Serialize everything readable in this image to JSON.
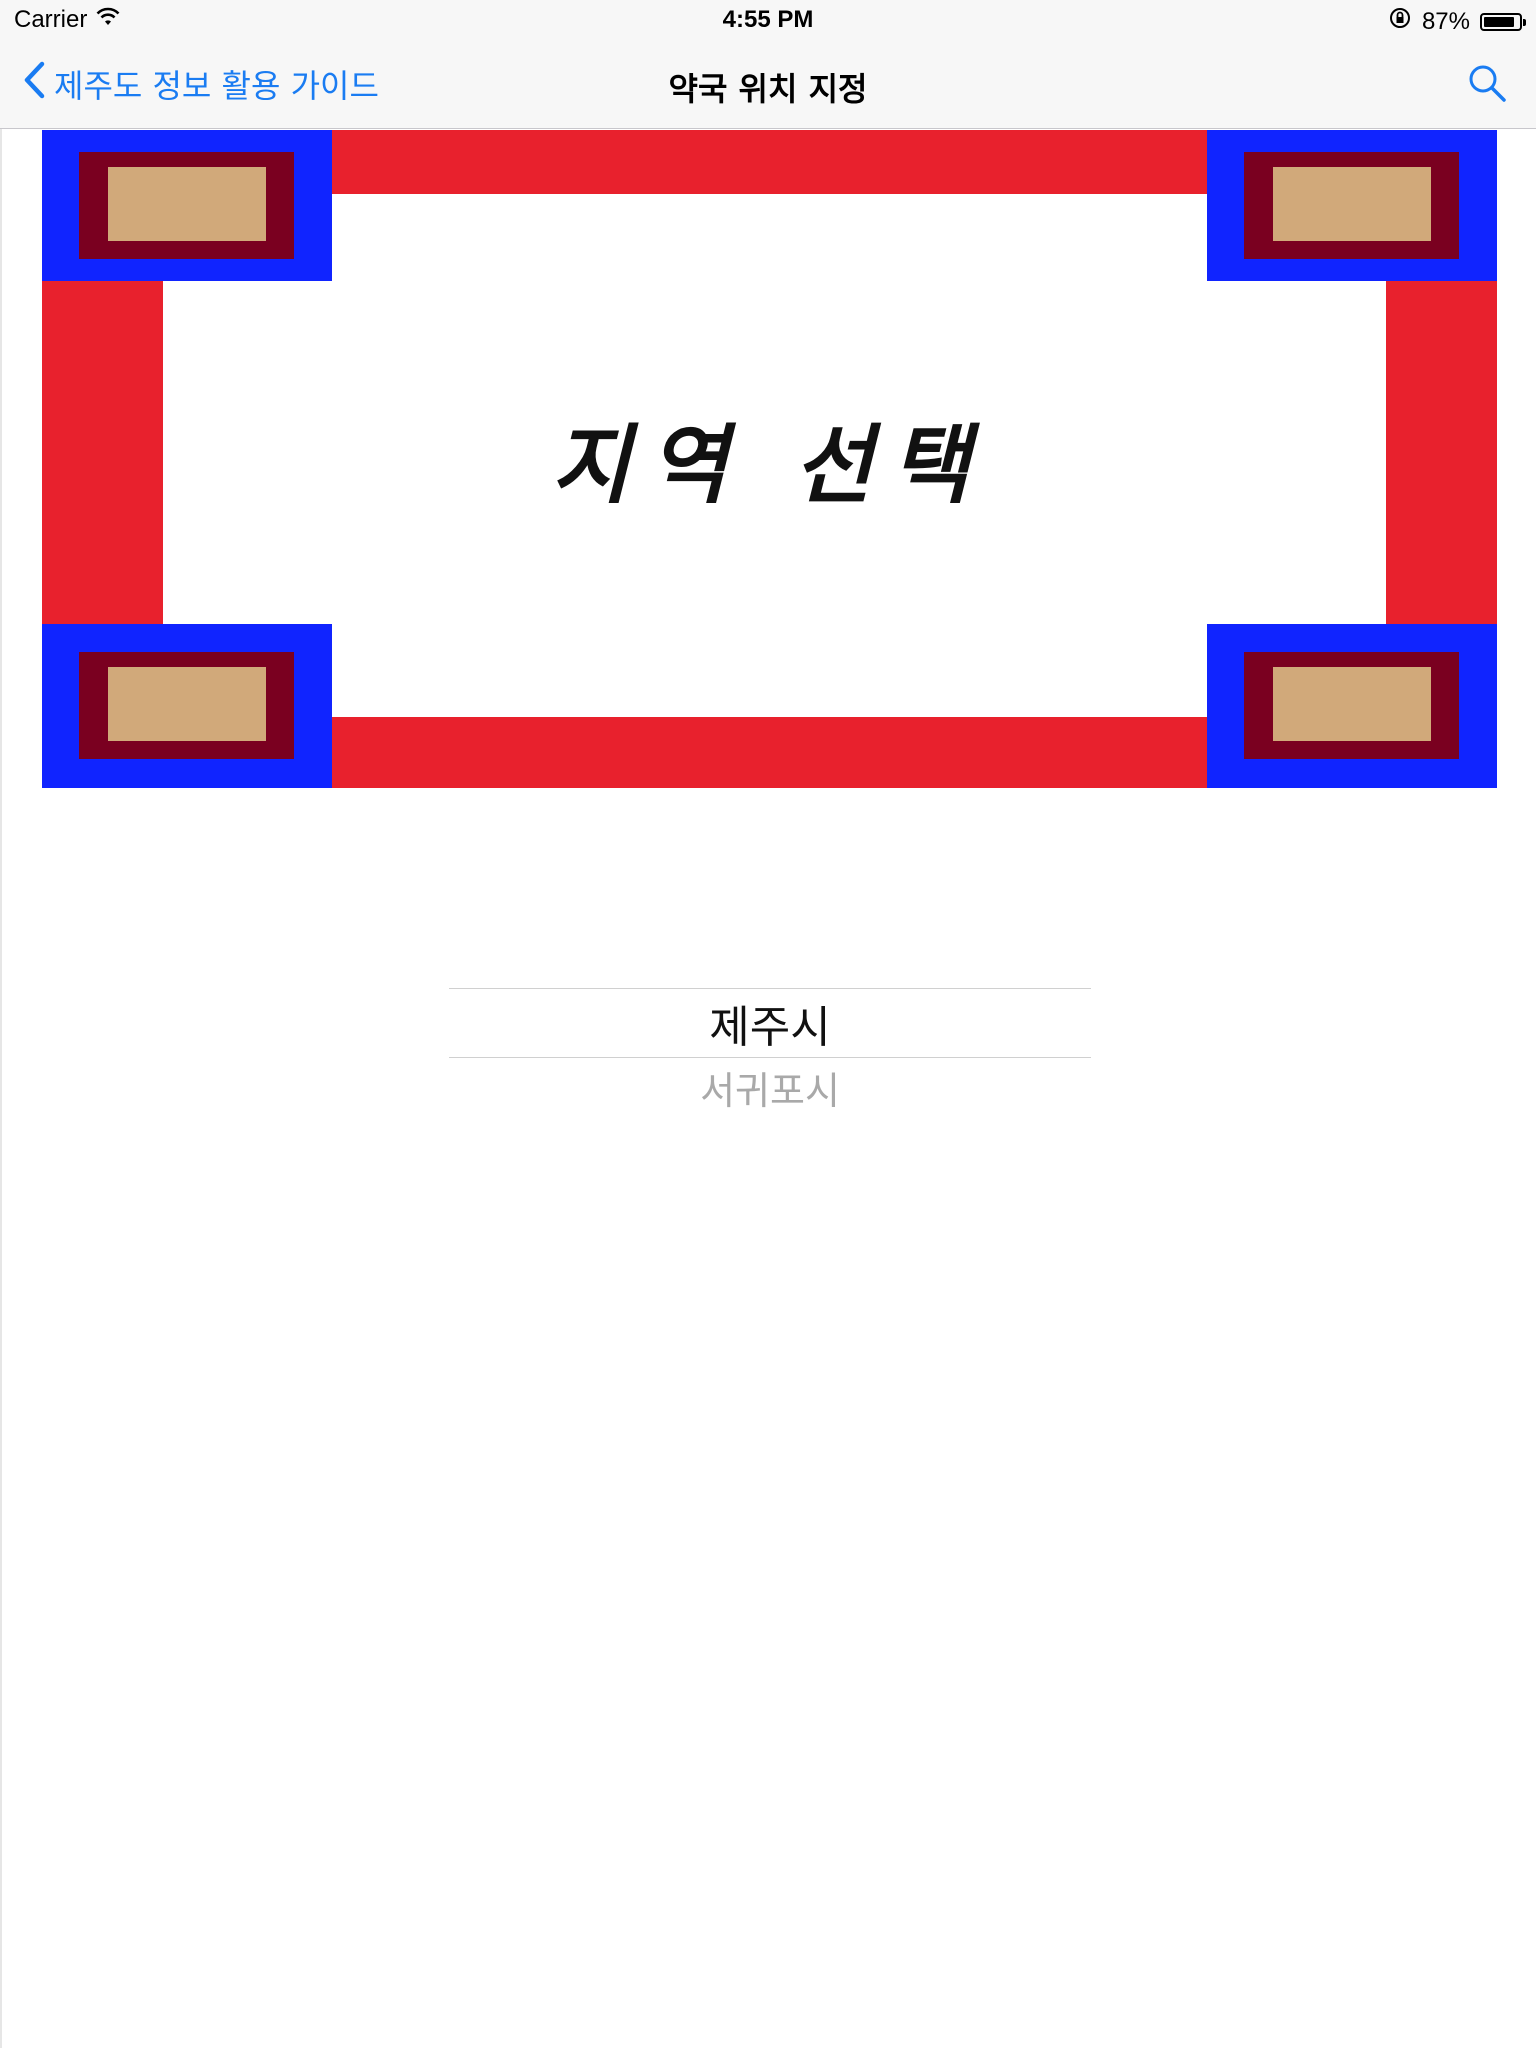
{
  "status_bar": {
    "carrier": "Carrier",
    "time": "4:55 PM",
    "battery": "87%",
    "battery_level": 0.87,
    "icons": [
      "wifi-icon",
      "rotation-lock-icon",
      "battery-icon"
    ]
  },
  "nav": {
    "back_label": "제주도 정보 활용 가이드",
    "title": "약국 위치 지정",
    "search_icon": "search-icon",
    "accent_color": "#1a7cf2"
  },
  "banner": {
    "text": "지역 선택",
    "colors": {
      "frame": "#e8212d",
      "corner": "#1024ff",
      "corner_inner": "#7a0020",
      "corner_core": "#d1a97a"
    }
  },
  "picker": {
    "selected": "제주시",
    "options": [
      "서귀포시"
    ]
  }
}
